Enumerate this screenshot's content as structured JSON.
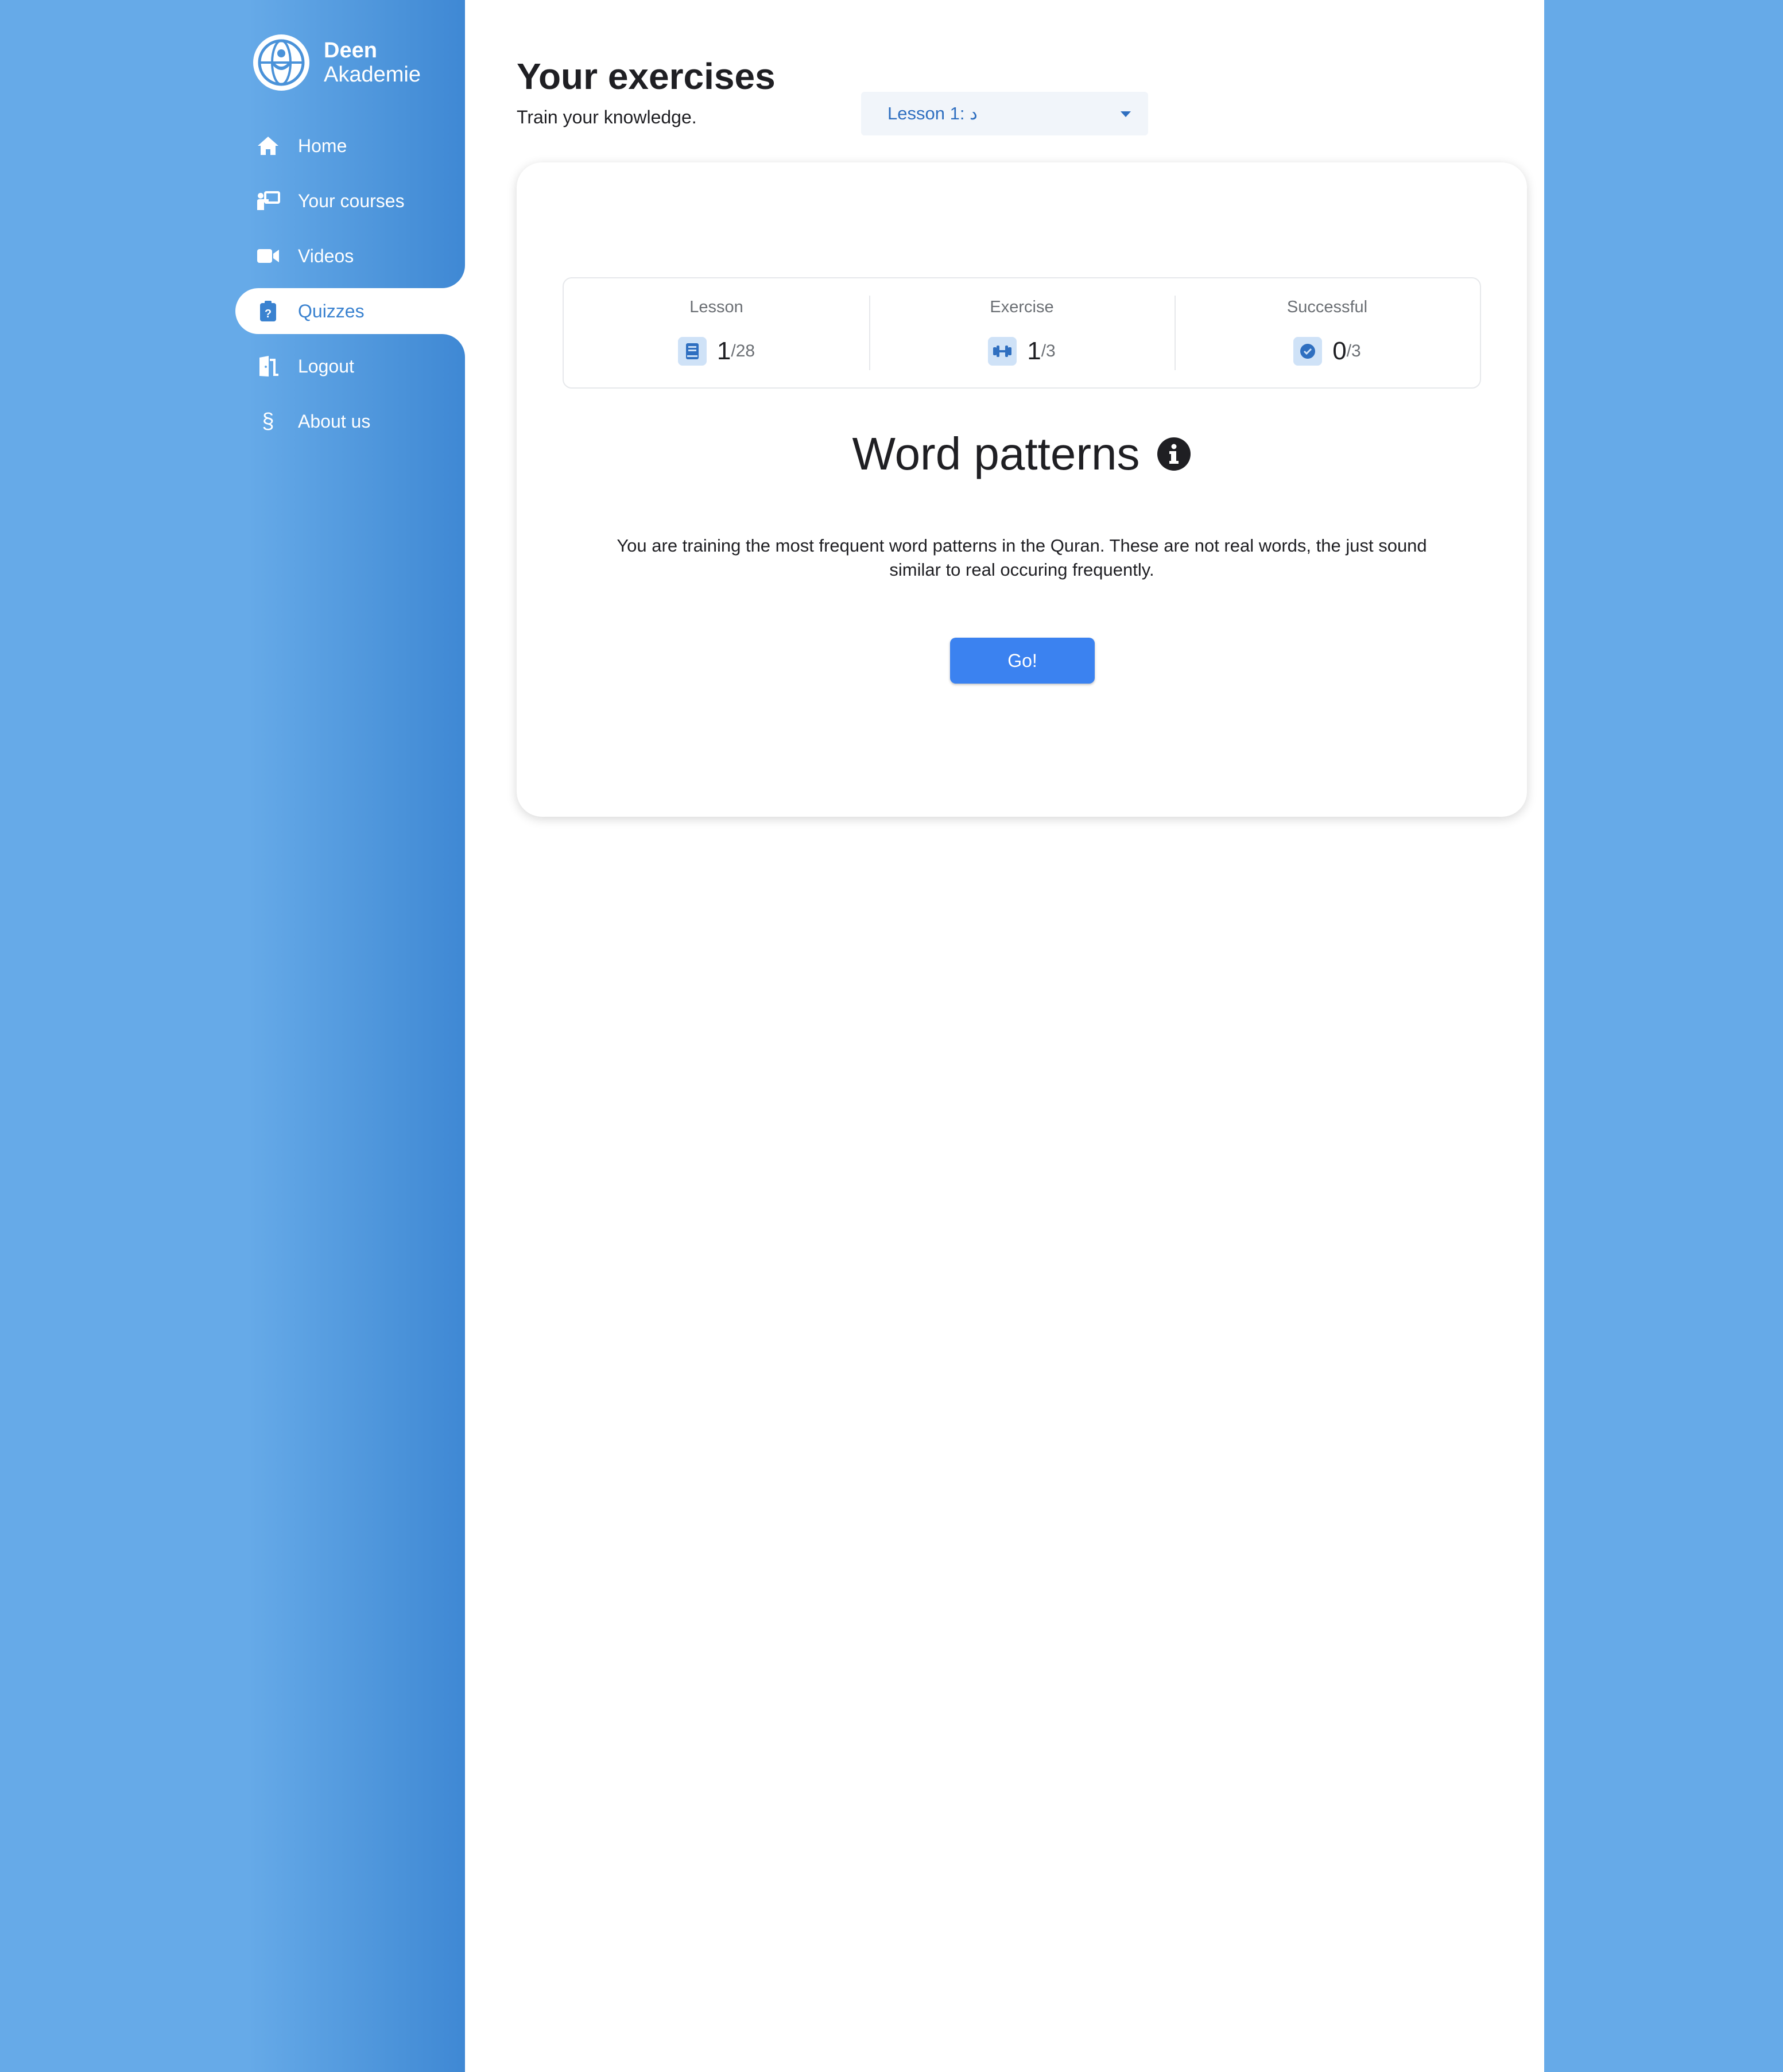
{
  "brand": {
    "line1": "Deen",
    "line2": "Akademie"
  },
  "sidebar": {
    "items": [
      {
        "label": "Home",
        "icon": "home-icon"
      },
      {
        "label": "Your courses",
        "icon": "teacher-board-icon"
      },
      {
        "label": "Videos",
        "icon": "video-camera-icon"
      },
      {
        "label": "Quizzes",
        "icon": "clipboard-question-icon",
        "active": true
      },
      {
        "label": "Logout",
        "icon": "door-exit-icon"
      },
      {
        "label": "About us",
        "icon": "section-sign-icon"
      }
    ]
  },
  "header": {
    "title": "Your exercises",
    "subtitle": "Train your knowledge."
  },
  "lesson_select": {
    "selected": "Lesson 1: د"
  },
  "stats": {
    "lesson": {
      "label": "Lesson",
      "current": "1",
      "total": "/28"
    },
    "exercise": {
      "label": "Exercise",
      "current": "1",
      "total": "/3"
    },
    "successful": {
      "label": "Successful",
      "current": "0",
      "total": "/3"
    }
  },
  "exercise": {
    "title": "Word patterns",
    "description": "You are training the most frequent word patterns in the Quran. These are not real words, the just sound similar to real occuring frequently.",
    "go_label": "Go!"
  },
  "colors": {
    "background": "#66aae8",
    "accent": "#3a82d0",
    "button": "#3b82f0"
  }
}
